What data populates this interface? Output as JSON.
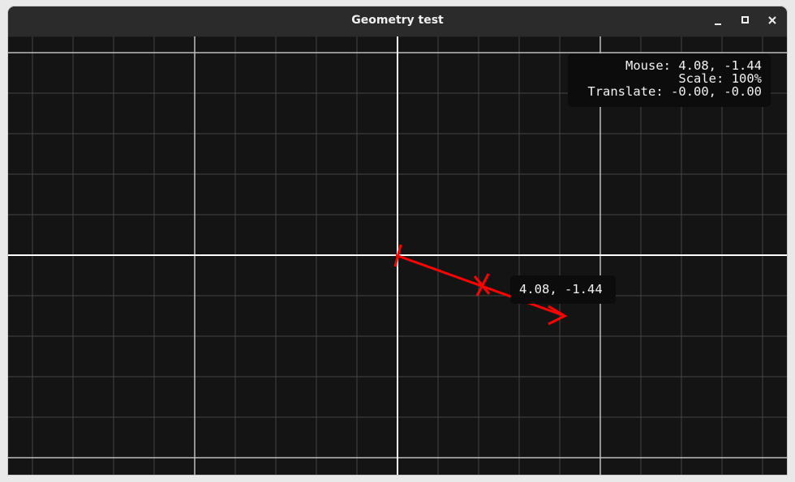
{
  "window": {
    "title": "Geometry test",
    "controls": [
      "minimize-icon",
      "maximize-icon",
      "close-icon"
    ]
  },
  "info": {
    "mouse": "Mouse: 4.08, -1.44",
    "scale": "Scale: 100%",
    "translate": "Translate: -0.00, -0.00"
  },
  "cursor_label": "4.08, -1.44",
  "colors": {
    "background": "#141414",
    "titlebar": "#2b2b2b",
    "grid_minor": "#444444",
    "grid_major": "#bdbdbd",
    "axis": "#ffffff",
    "vector": "#ff0000"
  }
}
